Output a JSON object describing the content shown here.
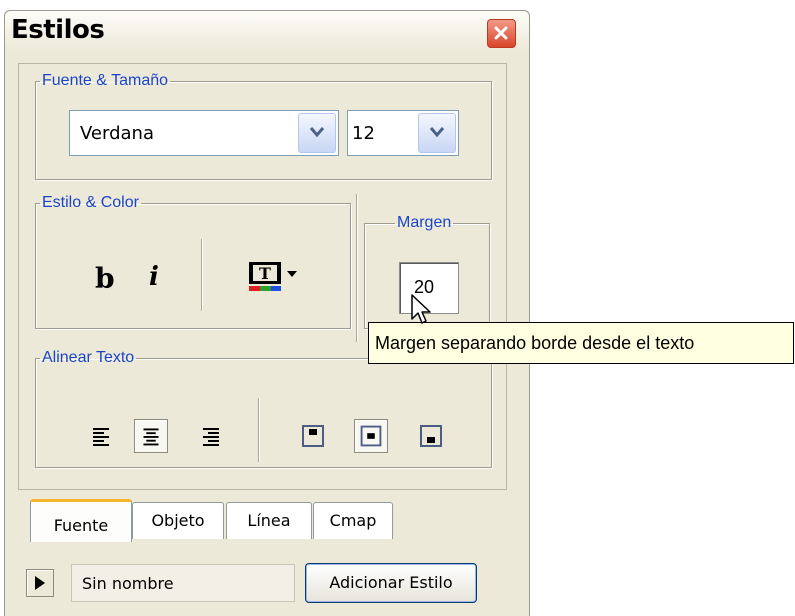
{
  "window": {
    "title": "Estilos"
  },
  "font_size_group": {
    "legend": "Fuente & Tamaño",
    "font_value": "Verdana",
    "size_value": "12"
  },
  "style_color_group": {
    "legend": "Estilo & Color",
    "bold_label": "b",
    "italic_label": "i"
  },
  "margin_group": {
    "legend": "Margen",
    "value": "20"
  },
  "tooltip": {
    "text": "Margen separando borde desde el texto"
  },
  "align_group": {
    "legend": "Alinear Texto"
  },
  "tabs": [
    {
      "label": "Fuente"
    },
    {
      "label": "Objeto"
    },
    {
      "label": "Línea"
    },
    {
      "label": "Cmap"
    }
  ],
  "footer": {
    "style_name": "Sin nombre",
    "add_style_label": "Adicionar Estilo"
  },
  "icons": [
    "close-icon",
    "dropdown-arrow-icon",
    "text-color-icon",
    "align-left-icon",
    "align-center-icon",
    "align-right-icon",
    "valign-top-icon",
    "valign-middle-icon",
    "valign-bottom-icon",
    "play-icon",
    "mouse-cursor-icon"
  ],
  "colors": {
    "legend_text": "#1a45c9",
    "window_bg": "#ece9d8",
    "tooltip_bg": "#ffffe1",
    "active_tab_accent": "#f5b52d"
  }
}
